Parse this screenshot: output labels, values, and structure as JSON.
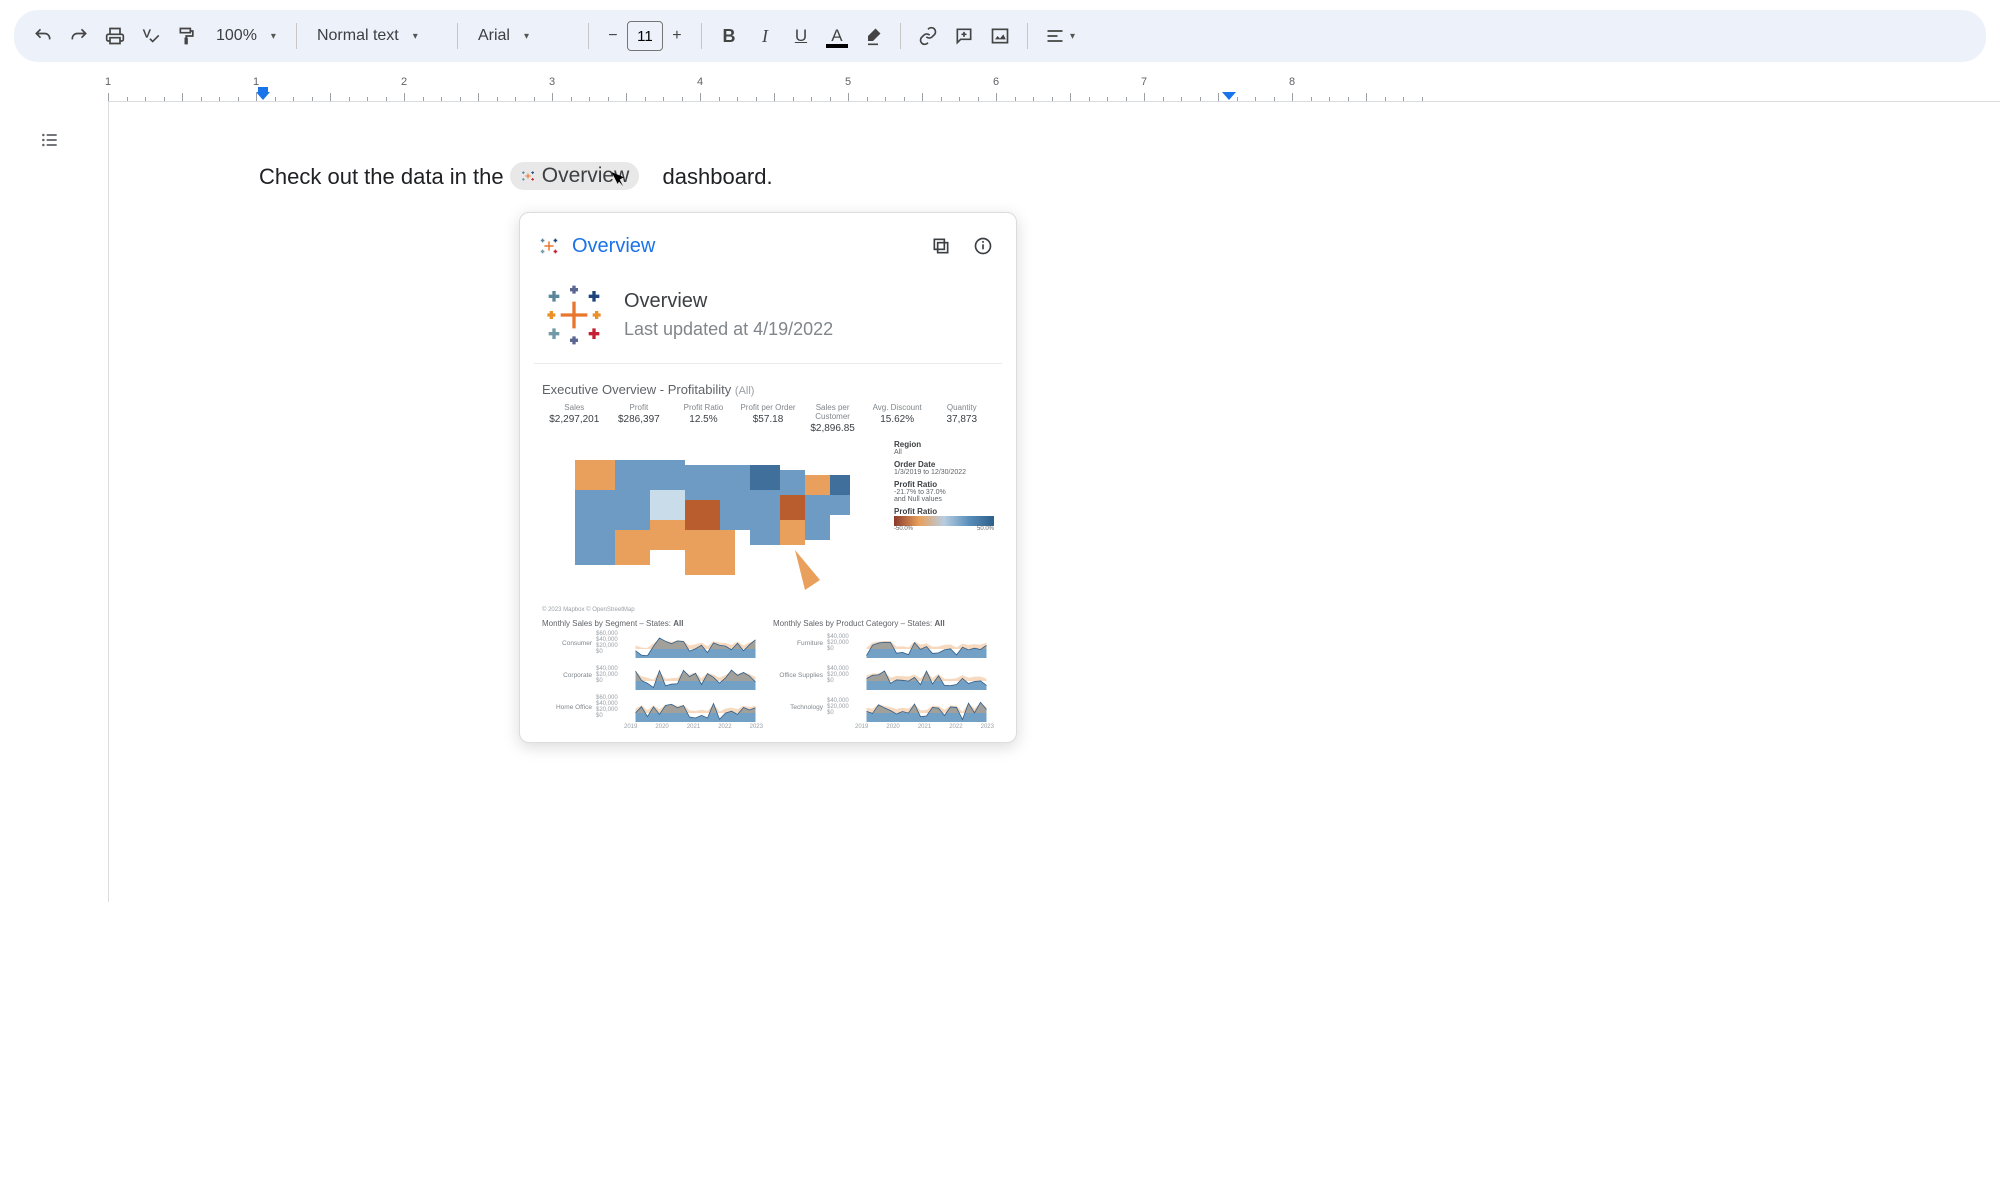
{
  "toolbar": {
    "zoom": "100%",
    "style": "Normal text",
    "font": "Arial",
    "font_size": "11"
  },
  "ruler": {
    "numbers": [
      1,
      1,
      2,
      3,
      4,
      5,
      6,
      7
    ]
  },
  "doc": {
    "text_before": "Check out the data in the ",
    "chip_label": "Overview",
    "text_after": " dashboard."
  },
  "popup": {
    "title": "Overview",
    "name": "Overview",
    "updated": "Last updated at 4/19/2022",
    "dash_title": "Executive Overview - Profitability",
    "dash_scope": "(All)",
    "kpis": [
      {
        "label": "Sales",
        "value": "$2,297,201"
      },
      {
        "label": "Profit",
        "value": "$286,397"
      },
      {
        "label": "Profit Ratio",
        "value": "12.5%"
      },
      {
        "label": "Profit per Order",
        "value": "$57.18"
      },
      {
        "label": "Sales per Customer",
        "value": "$2,896.85"
      },
      {
        "label": "Avg. Discount",
        "value": "15.62%"
      },
      {
        "label": "Quantity",
        "value": "37,873"
      }
    ],
    "map_attr": "© 2023 Mapbox © OpenStreetMap",
    "legend": {
      "region_lbl": "Region",
      "region_val": "All",
      "orderdate_lbl": "Order Date",
      "orderdate_val": "1/3/2019 to 12/30/2022",
      "pratio_lbl": "Profit Ratio",
      "pratio_range": "-21.7% to 37.0%",
      "pratio_note": "and Null values",
      "gradient_lbl": "Profit Ratio",
      "gmin": "-50.0%",
      "gmax": "50.0%"
    },
    "left_sub_title": "Monthly Sales by Segment – States:",
    "left_sub_scope": "All",
    "right_sub_title": "Monthly Sales by Product Category – States:",
    "right_sub_scope": "All",
    "left_rows": [
      {
        "label": "Consumer",
        "ax": [
          "$60,000",
          "$40,000",
          "$20,000",
          "$0"
        ]
      },
      {
        "label": "Corporate",
        "ax": [
          "$40,000",
          "$20,000",
          "$0"
        ]
      },
      {
        "label": "Home Office",
        "ax": [
          "$60,000",
          "$40,000",
          "$20,000",
          "$0"
        ]
      }
    ],
    "right_rows": [
      {
        "label": "Furniture",
        "ax": [
          "$40,000",
          "$20,000",
          "$0"
        ]
      },
      {
        "label": "Office Supplies",
        "ax": [
          "$40,000",
          "$20,000",
          "$0"
        ]
      },
      {
        "label": "Technology",
        "ax": [
          "$40,000",
          "$20,000",
          "$0"
        ]
      }
    ],
    "years": [
      "2019",
      "2020",
      "2021",
      "2022",
      "2023"
    ]
  }
}
